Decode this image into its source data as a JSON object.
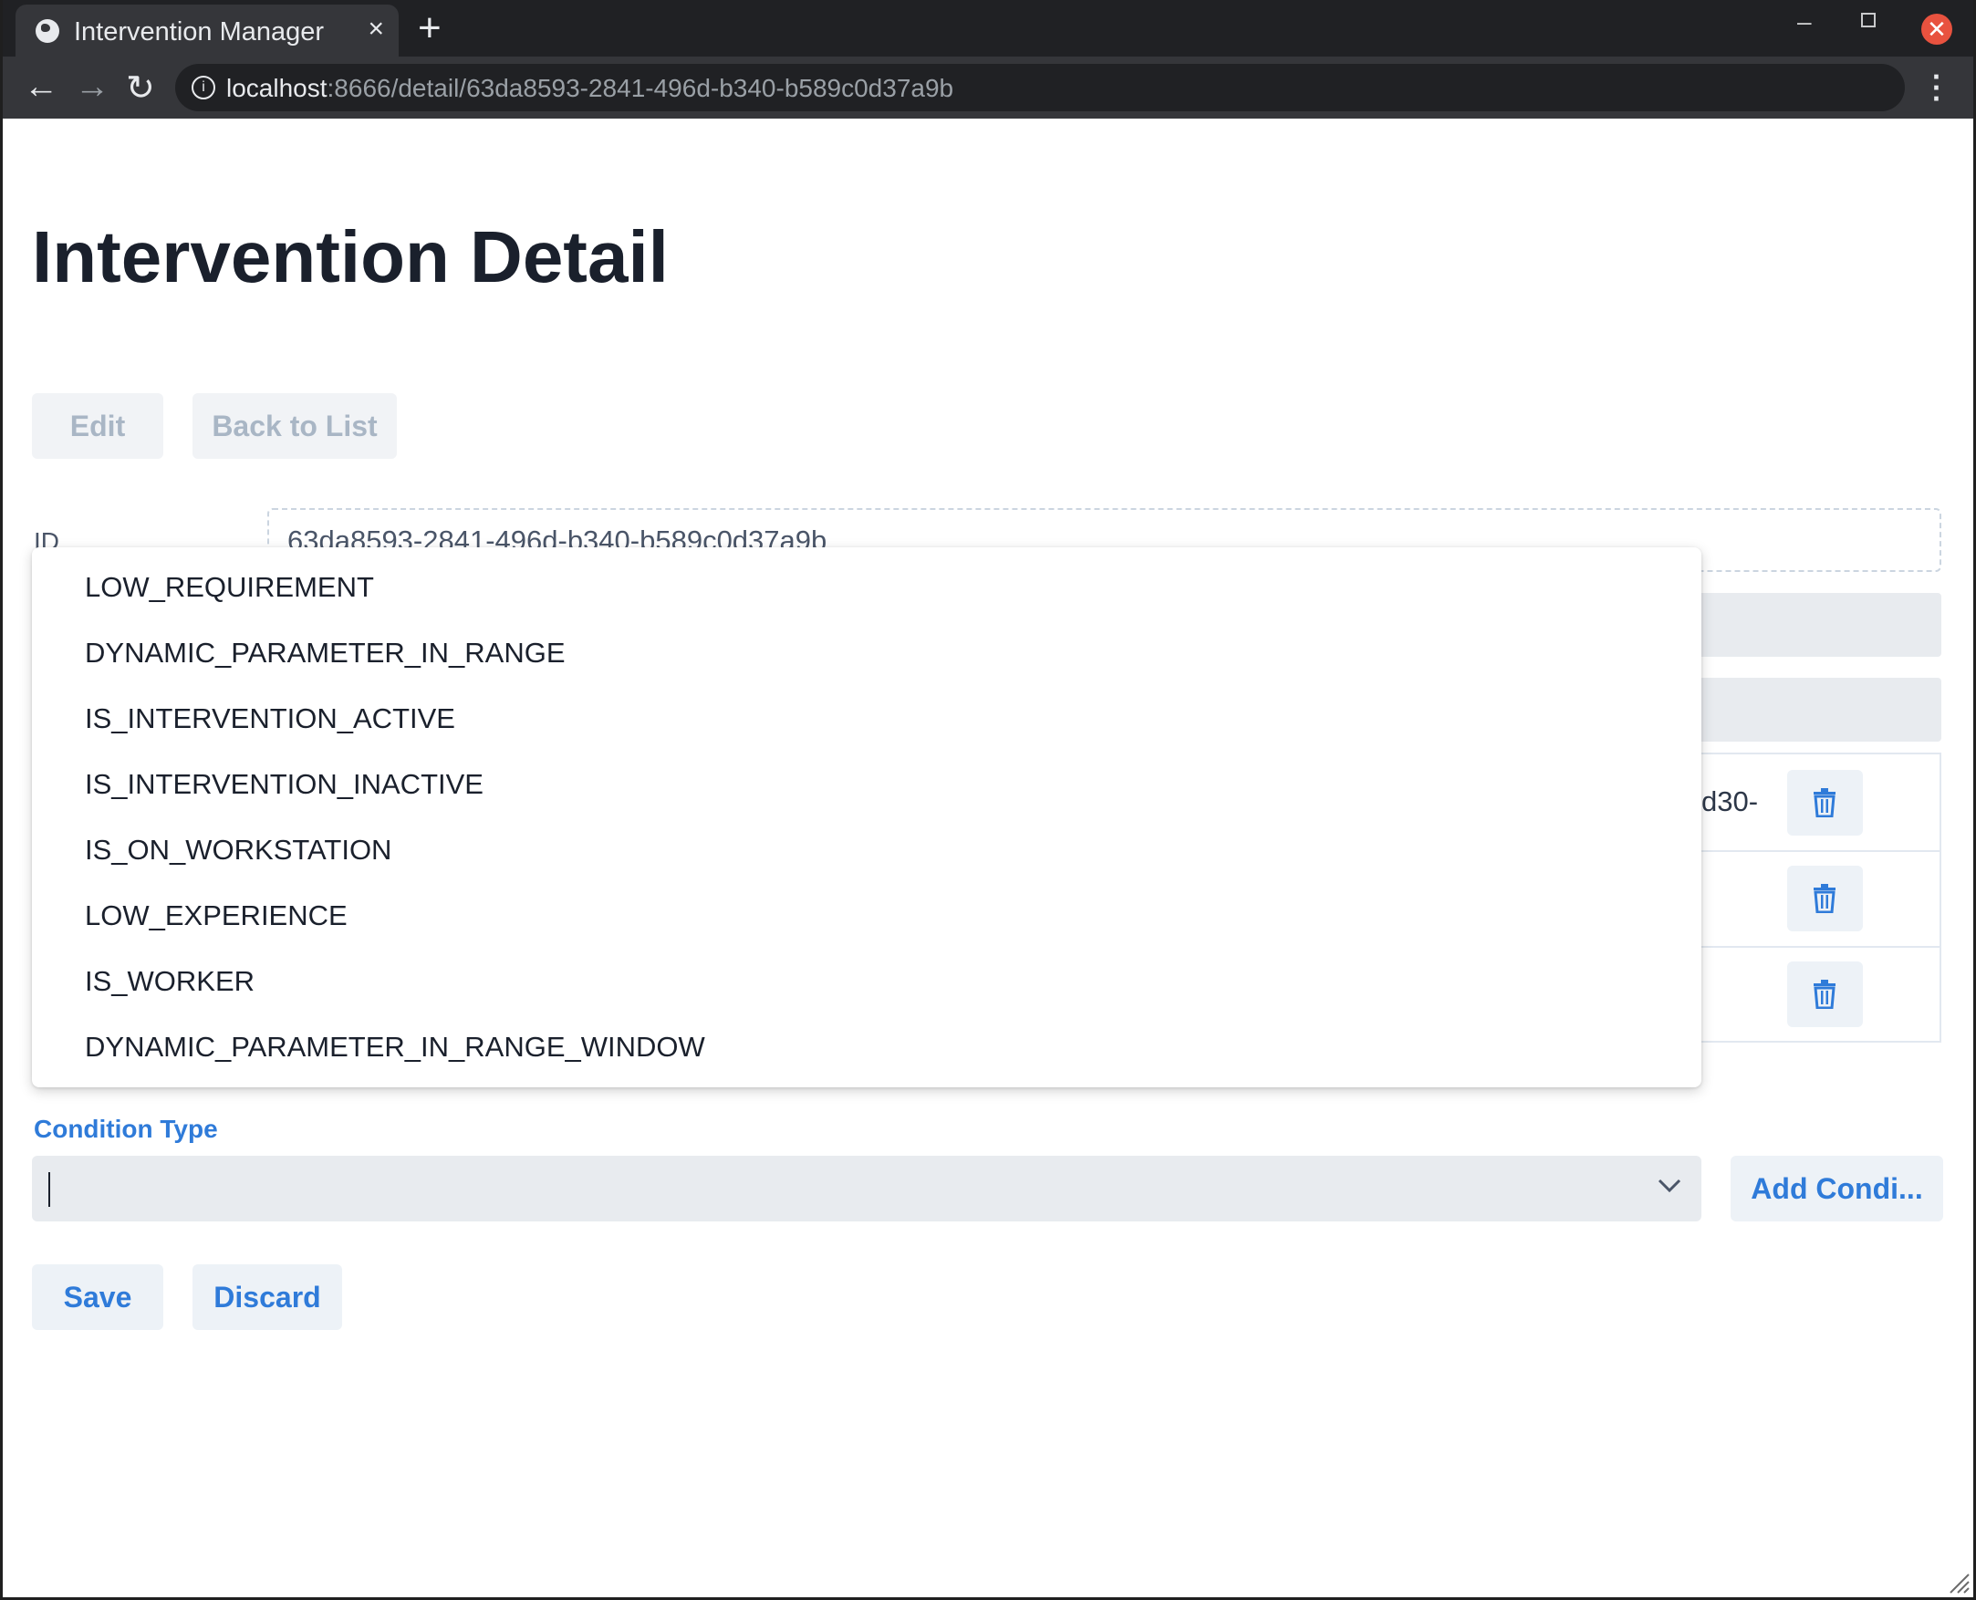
{
  "browser": {
    "tab_title": "Intervention Manager",
    "tab_close": "×",
    "new_tab": "+",
    "url_host": "localhost",
    "url_path": ":8666/detail/63da8593-2841-496d-b340-b589c0d37a9b",
    "info_glyph": "i"
  },
  "page": {
    "title": "Intervention Detail",
    "edit_label": "Edit",
    "back_label": "Back to List",
    "id_label": "ID",
    "id_value": "63da8593-2841-496d-b340-b589c0d37a9b"
  },
  "conditions": {
    "rows": [
      {
        "text": "d30-"
      },
      {
        "text": ""
      },
      {
        "text": ""
      }
    ]
  },
  "condition_type": {
    "label": "Condition Type",
    "value": "",
    "add_label": "Add Condi..."
  },
  "dropdown": {
    "options": [
      "LOW_REQUIREMENT",
      "DYNAMIC_PARAMETER_IN_RANGE",
      "IS_INTERVENTION_ACTIVE",
      "IS_INTERVENTION_INACTIVE",
      "IS_ON_WORKSTATION",
      "LOW_EXPERIENCE",
      "IS_WORKER",
      "DYNAMIC_PARAMETER_IN_RANGE_WINDOW"
    ]
  },
  "actions": {
    "save_label": "Save",
    "discard_label": "Discard"
  },
  "colors": {
    "accent": "#2f7bd9",
    "title": "#1a202c",
    "disabled_text": "#a9b6c5"
  }
}
